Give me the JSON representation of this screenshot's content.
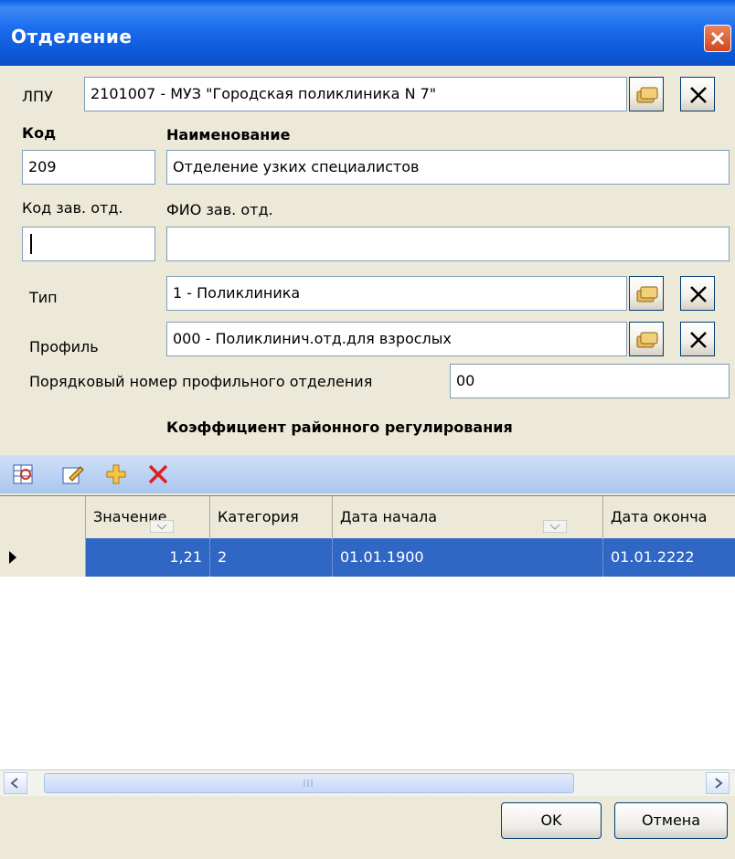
{
  "window": {
    "title": "Отделение"
  },
  "lpu": {
    "label": "ЛПУ",
    "value": "2101007 - МУЗ \"Городская поликлиника N 7\""
  },
  "code": {
    "label": "Код",
    "value": "209"
  },
  "name": {
    "label": "Наименование",
    "value": "Отделение узких специалистов"
  },
  "head_code": {
    "label": "Код зав. отд.",
    "value": ""
  },
  "head_name": {
    "label": "ФИО зав. отд.",
    "value": ""
  },
  "type": {
    "label": "Тип",
    "value": "1 - Поликлиника"
  },
  "profile": {
    "label": "Профиль",
    "value": "000 - Поликлинич.отд.для взрослых"
  },
  "profile_number": {
    "label": "Порядковый номер профильного отделения",
    "value": "00"
  },
  "coef_section": {
    "title": "Коэффициент районного регулирования"
  },
  "toolbar": {
    "icons": [
      "refresh-grid-icon",
      "edit-icon",
      "add-icon",
      "delete-icon"
    ]
  },
  "grid": {
    "columns": [
      "Значение",
      "Категория",
      "Дата начала",
      "Дата оконча"
    ],
    "rows": [
      {
        "value": "1,21",
        "category": "2",
        "start": "01.01.1900",
        "end": "01.01.2222"
      }
    ]
  },
  "buttons": {
    "ok": "OK",
    "cancel": "Отмена"
  },
  "colors": {
    "title_bar": "#0b58d8",
    "selection": "#3167c4",
    "toolbar": "#a9c6ee"
  }
}
